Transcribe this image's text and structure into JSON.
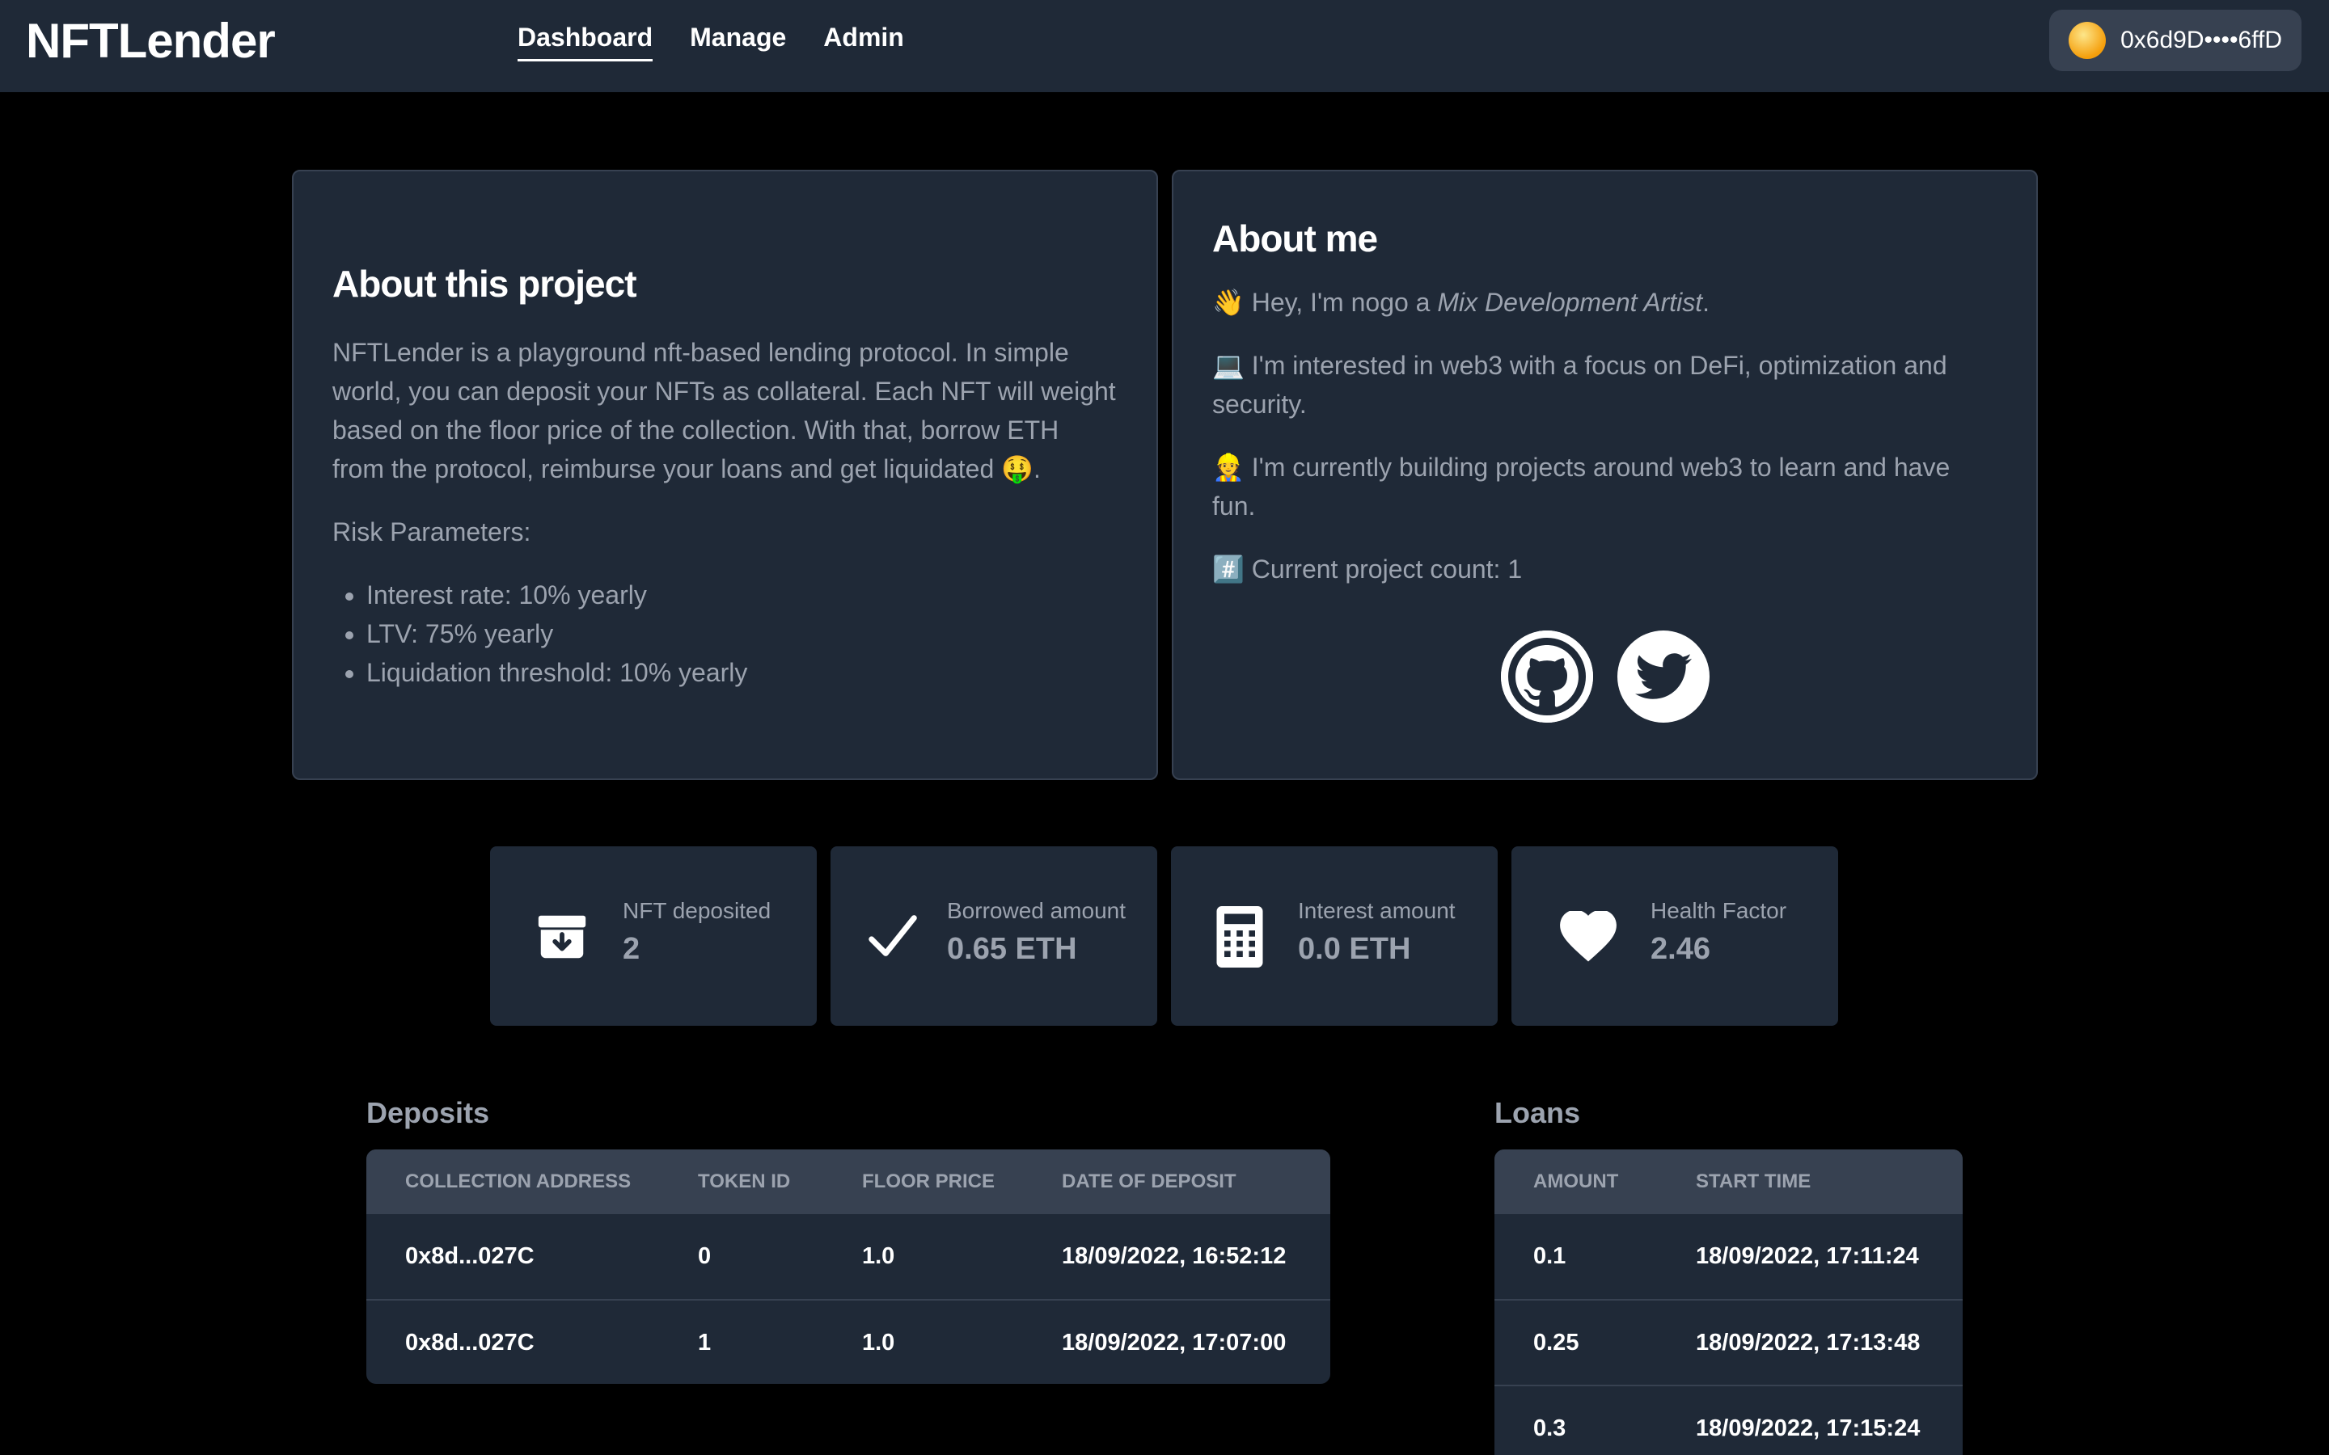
{
  "app": {
    "brand": "NFTLender"
  },
  "nav": {
    "items": [
      "Dashboard",
      "Manage",
      "Admin"
    ]
  },
  "wallet": {
    "address": "0x6d9D••••6ffD"
  },
  "about_project": {
    "title": "About this project",
    "description": "NFTLender is a playground nft-based lending protocol. In simple world, you can deposit your NFTs as collateral. Each NFT will weight based on the floor price of the collection. With that, borrow ETH from the protocol, reimburse your loans and get liquidated 🤑.",
    "risk_heading": "Risk Parameters:",
    "risk_items": [
      "Interest rate: 10% yearly",
      "LTV: 75% yearly",
      "Liquidation threshold: 10% yearly"
    ]
  },
  "about_me": {
    "title": "About me",
    "intro_prefix": "👋 Hey, I'm nogo a ",
    "intro_role": "Mix Development Artist",
    "intro_suffix": ".",
    "interest": "💻 I'm interested in web3 with a focus on DeFi, optimization and security.",
    "building": "👷 I'm currently building projects around web3 to learn and have fun.",
    "count": "#️⃣ Current project count: 1"
  },
  "stats": [
    {
      "label": "NFT deposited",
      "value": "2",
      "icon": "archive-icon"
    },
    {
      "label": "Borrowed amount",
      "value": "0.65 ETH",
      "icon": "check-icon"
    },
    {
      "label": "Interest amount",
      "value": "0.0 ETH",
      "icon": "calculator-icon"
    },
    {
      "label": "Health Factor",
      "value": "2.46",
      "icon": "heart-icon"
    }
  ],
  "deposits": {
    "title": "Deposits",
    "columns": [
      "Collection address",
      "Token ID",
      "Floor price",
      "Date of deposit"
    ],
    "rows": [
      [
        "0x8d...027C",
        "0",
        "1.0",
        "18/09/2022, 16:52:12"
      ],
      [
        "0x8d...027C",
        "1",
        "1.0",
        "18/09/2022, 17:07:00"
      ]
    ]
  },
  "loans": {
    "title": "Loans",
    "columns": [
      "Amount",
      "Start time"
    ],
    "rows": [
      [
        "0.1",
        "18/09/2022, 17:11:24"
      ],
      [
        "0.25",
        "18/09/2022, 17:13:48"
      ],
      [
        "0.3",
        "18/09/2022, 17:15:24"
      ]
    ]
  },
  "colors": {
    "topbar": "#1f2937",
    "card": "#1f2937",
    "muted_text": "#9ca3af",
    "background": "#000000"
  }
}
